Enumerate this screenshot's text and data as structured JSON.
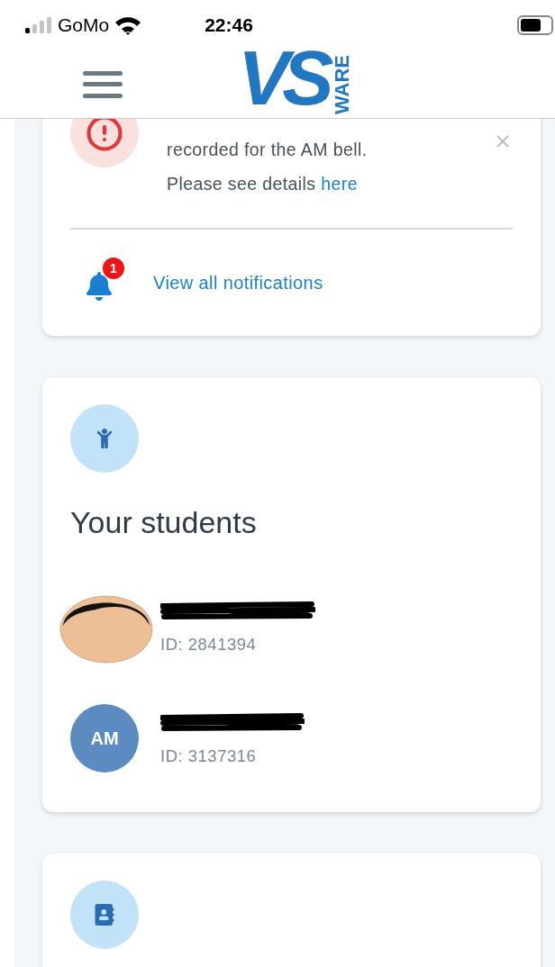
{
  "status_bar": {
    "carrier": "GoMo",
    "time": "22:46"
  },
  "header": {
    "logo": {
      "main": "VS",
      "side": "WARE"
    }
  },
  "notification": {
    "lines": [
      "recorded for the AM bell.",
      "Please see details "
    ],
    "link": "here",
    "badge": "1",
    "footer_link": "View all notifications"
  },
  "students_card": {
    "title": "Your students",
    "students": [
      {
        "kind": "photo",
        "id": "ID: 2841394"
      },
      {
        "kind": "initials",
        "initials": "AM",
        "id": "ID: 3137316"
      }
    ]
  }
}
